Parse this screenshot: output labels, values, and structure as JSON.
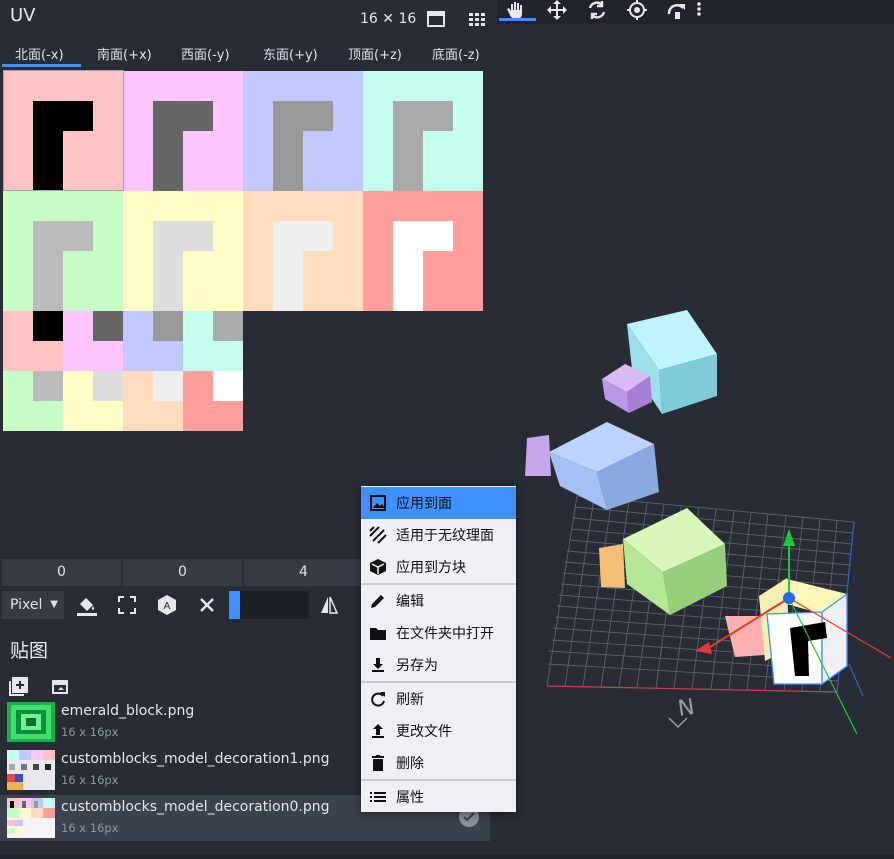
{
  "uv_panel": {
    "title": "UV",
    "size_label": "16 ✕ 16",
    "tabs": [
      "北面(-x)",
      "南面(+x)",
      "西面(-y)",
      "东面(+y)",
      "顶面(+z)",
      "底面(-z)"
    ],
    "inputs": [
      "0",
      "0",
      "4"
    ],
    "toolbar": {
      "mode_label": "Pixel"
    }
  },
  "textures": {
    "title": "贴图",
    "items": [
      {
        "name": "emerald_block.png",
        "size": "16 x 16px"
      },
      {
        "name": "customblocks_model_decoration1.png",
        "size": "16 x 16px"
      },
      {
        "name": "customblocks_model_decoration0.png",
        "size": "16 x 16px"
      }
    ]
  },
  "context_menu": {
    "items": [
      {
        "label": "应用到面",
        "icon": "image-icon"
      },
      {
        "label": "适用于无纹理面",
        "icon": "hatch-icon"
      },
      {
        "label": "应用到方块",
        "icon": "cube-icon"
      },
      {
        "label": "编辑",
        "icon": "pencil-icon"
      },
      {
        "label": "在文件夹中打开",
        "icon": "folder-icon"
      },
      {
        "label": "另存为",
        "icon": "download-icon"
      },
      {
        "label": "刷新",
        "icon": "refresh-icon"
      },
      {
        "label": "更改文件",
        "icon": "upload-icon"
      },
      {
        "label": "删除",
        "icon": "trash-icon"
      },
      {
        "label": "属性",
        "icon": "list-icon"
      }
    ]
  },
  "viewport": {
    "compass_label": "N"
  },
  "colors": {
    "accent": "#3e90ff",
    "panel": "#282c34",
    "menu": "#eef0f4"
  }
}
